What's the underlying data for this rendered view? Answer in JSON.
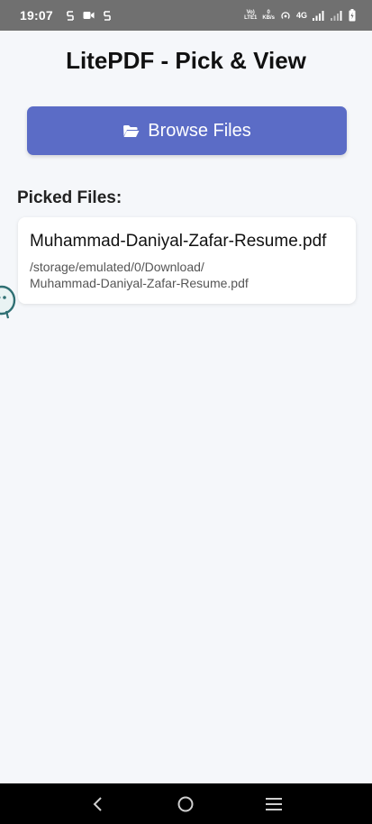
{
  "status_bar": {
    "time": "19:07",
    "volte_label_top": "Vo)",
    "volte_label_bottom": "LTE1",
    "speed_value": "0",
    "speed_unit": "KB/s",
    "network_label": "4G"
  },
  "app": {
    "title": "LitePDF - Pick & View",
    "browse_button_label": "Browse Files",
    "picked_files_title": "Picked Files:",
    "files": [
      {
        "name": "Muhammad-Daniyal-Zafar-Resume.pdf",
        "path": "/storage/emulated/0/Download/\nMuhammad-Daniyal-Zafar-Resume.pdf"
      }
    ]
  },
  "colors": {
    "accent": "#5b6cc6",
    "background": "#f5f7fa",
    "status_bar": "#707070",
    "nav_bar": "#000000"
  },
  "icons": {
    "browse": "folder-open-icon",
    "nav_back": "back-icon",
    "nav_home": "home-icon",
    "nav_recents": "menu-icon"
  }
}
